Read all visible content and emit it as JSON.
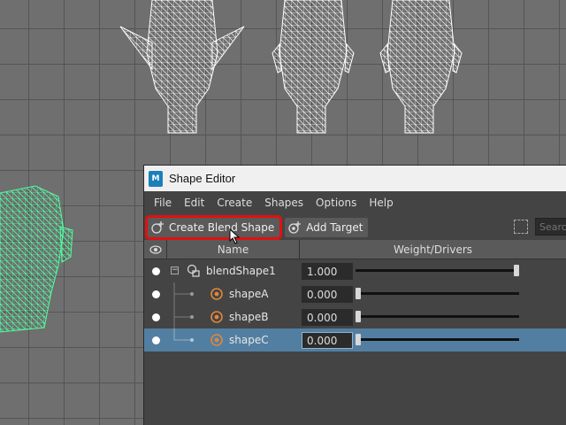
{
  "window": {
    "title": "Shape Editor",
    "app_icon": "M"
  },
  "menubar": {
    "items": [
      "File",
      "Edit",
      "Create",
      "Shapes",
      "Options",
      "Help"
    ]
  },
  "toolbar": {
    "create_blend_shape": "Create Blend Shape",
    "add_target": "Add Target",
    "search_placeholder": "Search"
  },
  "table": {
    "columns": [
      "Name",
      "Weight/Drivers"
    ],
    "rows": [
      {
        "name": "blendShape1",
        "weight": "1.000",
        "level": 0,
        "selected": false,
        "fraction": 1.0
      },
      {
        "name": "shapeA",
        "weight": "0.000",
        "level": 1,
        "selected": false,
        "fraction": 0.0
      },
      {
        "name": "shapeB",
        "weight": "0.000",
        "level": 1,
        "selected": false,
        "fraction": 0.0
      },
      {
        "name": "shapeC",
        "weight": "0.000",
        "level": 1,
        "selected": true,
        "fraction": 0.0
      }
    ]
  },
  "colors": {
    "selection": "#527fa1",
    "highlight": "#e01010",
    "wire_selected": "#4dff9e",
    "panel": "#444444"
  }
}
